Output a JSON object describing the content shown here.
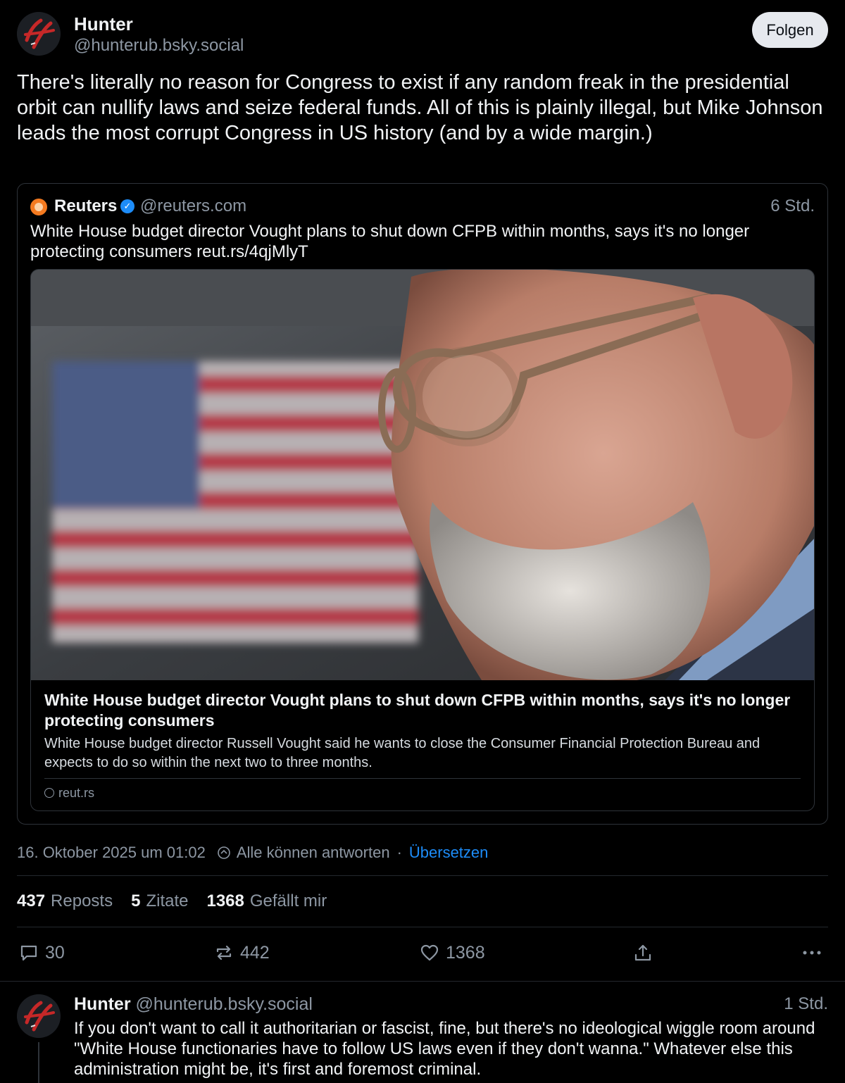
{
  "post": {
    "author_name": "Hunter",
    "author_handle": "@hunterub.bsky.social",
    "follow_label": "Folgen",
    "text": "There's literally no reason for Congress to exist if any random freak in the presidential orbit can nullify laws and seize federal funds. All of this is plainly illegal, but Mike Johnson leads the most corrupt Congress in US history (and by a wide margin.)",
    "avatar_icon": "hunter-logo-avatar"
  },
  "quote": {
    "name": "Reuters",
    "verified_icon": "verified-check-icon",
    "handle": "@reuters.com",
    "time": "6 Std.",
    "text": "White House budget director Vought plans to shut down CFPB within months, says it's no longer protecting consumers reut.rs/4qjMlyT",
    "embed": {
      "image_icon": "news-photo-man-with-glasses-and-american-flag",
      "title": "White House budget director Vought plans to shut down CFPB within months, says it's no longer protecting consumers",
      "description": "White House budget director Russell Vought said he wants to close the Consumer Financial Protection Bureau and expects to do so within the next two to three months.",
      "domain": "reut.rs"
    }
  },
  "meta": {
    "date": "16. Oktober 2025 um 01:02",
    "reply_setting": "Alle können antworten",
    "separator": "·",
    "translate": "Übersetzen"
  },
  "stats": {
    "reposts_count": "437",
    "reposts_label": "Reposts",
    "quotes_count": "5",
    "quotes_label": "Zitate",
    "likes_count": "1368",
    "likes_label": "Gefällt mir"
  },
  "actions": {
    "reply_count": "30",
    "repost_count": "442",
    "like_count": "1368"
  },
  "reply": {
    "author_name": "Hunter",
    "author_handle": "@hunterub.bsky.social",
    "time": "1 Std.",
    "text": "If you don't want to call it authoritarian or fascist, fine, but there's no ideological wiggle room around \"White House functionaries have to follow US laws even if they don't wanna.\" Whatever else this administration might be, it's first and foremost criminal."
  },
  "colors": {
    "background": "#000000",
    "text": "#f1f3f5",
    "muted": "#8d97a3",
    "link": "#1d8cf8",
    "border": "#2e3339",
    "avatar_red": "#c62828"
  }
}
